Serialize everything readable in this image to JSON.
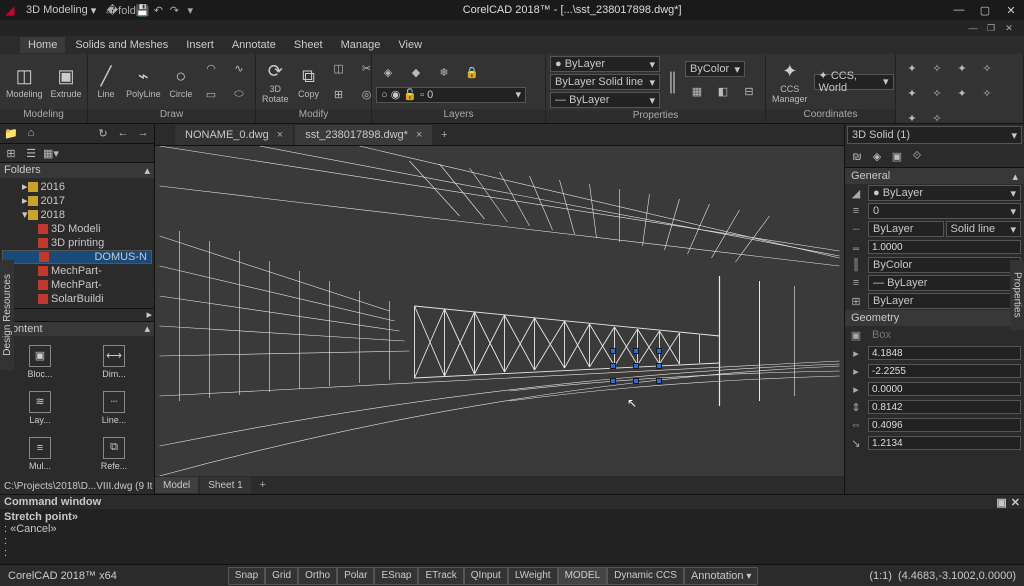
{
  "title": "CorelCAD 2018™ - [...\\sst_238017898.dwg*]",
  "workspace_label": "3D Modeling",
  "menu": {
    "items": [
      "Home",
      "Solids and Meshes",
      "Insert",
      "Annotate",
      "Sheet",
      "Manage",
      "View"
    ],
    "active": 0
  },
  "ribbon": {
    "groups": {
      "modeling": {
        "label": "Modeling",
        "big": [
          {
            "l": "Modeling"
          },
          {
            "l": "Extrude"
          }
        ]
      },
      "draw": {
        "label": "Draw",
        "big": [
          {
            "l": "Line"
          },
          {
            "l": "PolyLine"
          },
          {
            "l": "Circle"
          }
        ]
      },
      "rotate": {
        "label": "3D\nRotate"
      },
      "copy": {
        "label": "Copy"
      },
      "modify": {
        "label": "Modify"
      },
      "layers": {
        "label": "Layers"
      },
      "properties": {
        "label": "Properties",
        "color": "ByLayer",
        "line": "Solid line",
        "lineprefix": "ByLayer",
        "weight": "ByLayer",
        "bycolor": "ByColor"
      },
      "ccs": {
        "label": "CCS\nManager",
        "world": "CCS, World"
      },
      "coords": {
        "label": "Coordinates"
      }
    }
  },
  "folders": {
    "title": "Folders",
    "years": [
      "2016",
      "2017",
      "2018"
    ],
    "items": [
      "3D Modeli",
      "3D printing",
      "DOMUS-N",
      "MechPart-",
      "MechPart-",
      "SolarBuildi"
    ],
    "selected": 2
  },
  "content": {
    "title": "Content",
    "items": [
      "Bloc...",
      "Dim...",
      "Lay...",
      "Line...",
      "Mul...",
      "Refe..."
    ]
  },
  "path": "C:\\Projects\\2018\\D...VIII.dwg (9 It",
  "tabs": {
    "files": [
      {
        "name": "NONAME_0.dwg",
        "active": false
      },
      {
        "name": "sst_238017898.dwg*",
        "active": true
      }
    ],
    "sheets": [
      {
        "name": "Model",
        "active": true
      },
      {
        "name": "Sheet 1",
        "active": false
      }
    ]
  },
  "props": {
    "selector": "3D Solid (1)",
    "general_title": "General",
    "layer": "ByLayer",
    "zero": "0",
    "linestyle_a": "ByLayer",
    "linestyle_b": "Solid line",
    "scale": "1.0000",
    "color": "ByColor",
    "weight": "ByLayer",
    "plot": "ByLayer",
    "geometry_title": "Geometry",
    "type": "Box",
    "x": "4.1848",
    "y": "-2.2255",
    "z": "0.0000",
    "h": "0.8142",
    "w": "0.4096",
    "d": "1.2134"
  },
  "cmd": {
    "title": "Command window",
    "lines": [
      "Stretch point»",
      ": «Cancel»",
      ":",
      ":"
    ]
  },
  "status": {
    "app": "CorelCAD 2018™ x64",
    "buttons": [
      "Snap",
      "Grid",
      "Ortho",
      "Polar",
      "ESnap",
      "ETrack",
      "QInput",
      "LWeight",
      "MODEL",
      "Dynamic CCS",
      "Annotation"
    ],
    "on": [
      8
    ],
    "scale": "(1:1)",
    "coords": "(4.4683,-3.1002,0.0000)"
  },
  "sidetabs": {
    "left": "Design Resources",
    "right": "Properties"
  }
}
